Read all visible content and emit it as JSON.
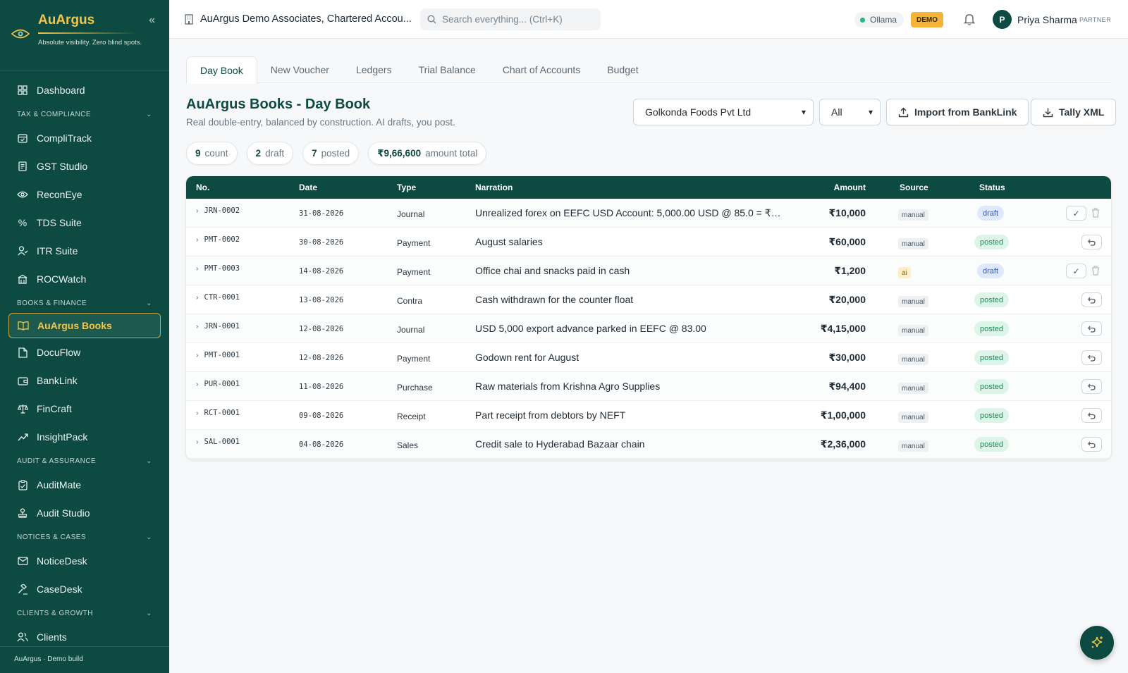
{
  "brand": {
    "name": "AuArgus",
    "tagline": "Absolute visibility. Zero blind spots.",
    "collapse_glyph": "«",
    "footer": "AuArgus · Demo build"
  },
  "sidebar": {
    "dashboard": "Dashboard",
    "sections": {
      "tax": "TAX & COMPLIANCE",
      "books": "BOOKS & FINANCE",
      "audit": "AUDIT & ASSURANCE",
      "notices": "NOTICES & CASES",
      "clients": "CLIENTS & GROWTH"
    },
    "items": {
      "complitrack": "CompliTrack",
      "gst": "GST Studio",
      "reconeye": "ReconEye",
      "tds": "TDS Suite",
      "itr": "ITR Suite",
      "rocwatch": "ROCWatch",
      "books": "AuArgus Books",
      "docuflow": "DocuFlow",
      "banklink": "BankLink",
      "fincraft": "FinCraft",
      "insightpack": "InsightPack",
      "auditmate": "AuditMate",
      "auditstudio": "Audit Studio",
      "noticedesk": "NoticeDesk",
      "casedesk": "CaseDesk",
      "clients": "Clients"
    }
  },
  "header": {
    "org": "AuArgus Demo Associates, Chartered Accou...",
    "search_placeholder": "Search everything... (Ctrl+K)",
    "ollama": "Ollama",
    "demo_badge": "DEMO",
    "user_initial": "P",
    "user_name": "Priya Sharma",
    "user_role": "PARTNER"
  },
  "tabs": [
    "Day Book",
    "New Voucher",
    "Ledgers",
    "Trial Balance",
    "Chart of Accounts",
    "Budget"
  ],
  "page": {
    "title": "AuArgus Books - Day Book",
    "subtitle": "Real double-entry, balanced by construction. AI drafts, you post.",
    "company_select": "Golkonda Foods Pvt Ltd",
    "filter_select": "All",
    "import_button": "Import from BankLink",
    "tally_button": "Tally XML"
  },
  "stats": {
    "count_value": "9",
    "count_label": "count",
    "draft_value": "2",
    "draft_label": "draft",
    "posted_value": "7",
    "posted_label": "posted",
    "amount_value": "₹9,66,600",
    "amount_label": "amount total"
  },
  "table": {
    "headers": {
      "no": "No.",
      "date": "Date",
      "type": "Type",
      "narration": "Narration",
      "amount": "Amount",
      "source": "Source",
      "status": "Status"
    },
    "rows": [
      {
        "no": "JRN-0002",
        "date": "31-08-2026",
        "type": "Journal",
        "narration": "Unrealized forex on EEFC USD Account: 5,000.00 USD @ 85.0 = ₹4,...",
        "amount": "₹10,000",
        "source": "manual",
        "status": "draft"
      },
      {
        "no": "PMT-0002",
        "date": "30-08-2026",
        "type": "Payment",
        "narration": "August salaries",
        "amount": "₹60,000",
        "source": "manual",
        "status": "posted"
      },
      {
        "no": "PMT-0003",
        "date": "14-08-2026",
        "type": "Payment",
        "narration": "Office chai and snacks paid in cash",
        "amount": "₹1,200",
        "source": "ai",
        "status": "draft"
      },
      {
        "no": "CTR-0001",
        "date": "13-08-2026",
        "type": "Contra",
        "narration": "Cash withdrawn for the counter float",
        "amount": "₹20,000",
        "source": "manual",
        "status": "posted"
      },
      {
        "no": "JRN-0001",
        "date": "12-08-2026",
        "type": "Journal",
        "narration": "USD 5,000 export advance parked in EEFC @ 83.00",
        "amount": "₹4,15,000",
        "source": "manual",
        "status": "posted"
      },
      {
        "no": "PMT-0001",
        "date": "12-08-2026",
        "type": "Payment",
        "narration": "Godown rent for August",
        "amount": "₹30,000",
        "source": "manual",
        "status": "posted"
      },
      {
        "no": "PUR-0001",
        "date": "11-08-2026",
        "type": "Purchase",
        "narration": "Raw materials from Krishna Agro Supplies",
        "amount": "₹94,400",
        "source": "manual",
        "status": "posted"
      },
      {
        "no": "RCT-0001",
        "date": "09-08-2026",
        "type": "Receipt",
        "narration": "Part receipt from debtors by NEFT",
        "amount": "₹1,00,000",
        "source": "manual",
        "status": "posted"
      },
      {
        "no": "SAL-0001",
        "date": "04-08-2026",
        "type": "Sales",
        "narration": "Credit sale to Hyderabad Bazaar chain",
        "amount": "₹2,36,000",
        "source": "manual",
        "status": "posted"
      }
    ]
  },
  "colors": {
    "brand_green": "#0d4a41",
    "gold": "#f3c64a",
    "draft_blue": "#2f5bb5",
    "posted_green": "#1b8a5a"
  }
}
